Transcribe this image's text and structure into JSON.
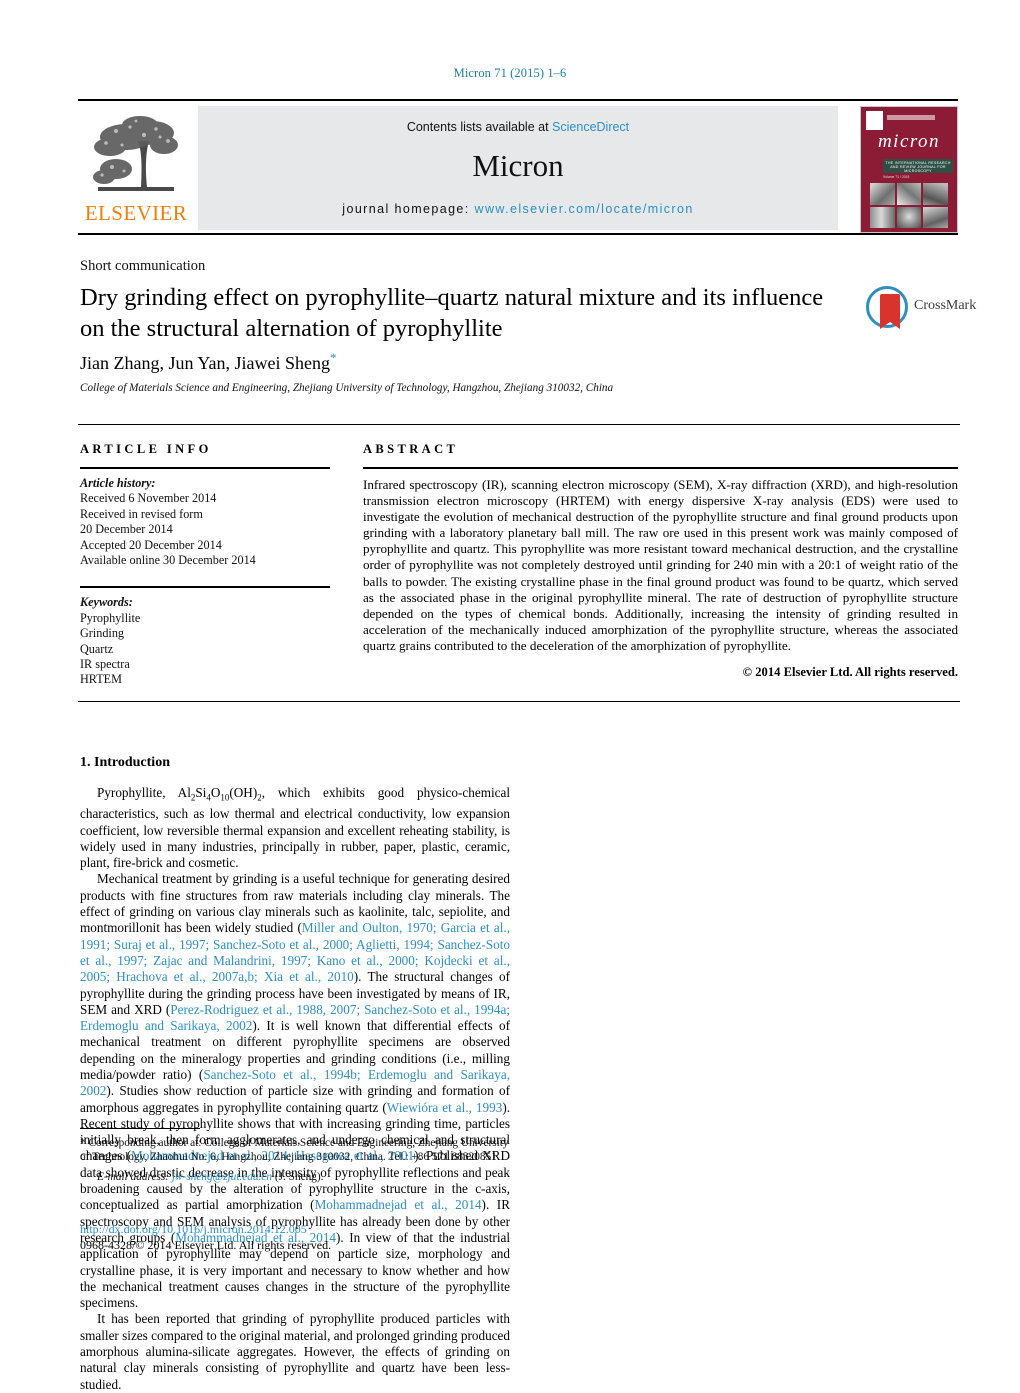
{
  "running_head": "Micron 71 (2015) 1–6",
  "masthead": {
    "contents_label": "Contents lists available at",
    "sciencedirect": "ScienceDirect",
    "journal_name": "Micron",
    "homepage_label": "journal homepage:",
    "homepage_url": "www.elsevier.com/locate/micron",
    "publisher_logo_text": "ELSEVIER",
    "cover": {
      "title": "micron",
      "band_text": "THE INTERNATIONAL RESEARCH AND REVIEW JOURNAL FOR MICROSCOPY",
      "sub_text": "Volume 71 / 2015"
    }
  },
  "article": {
    "doctype": "Short communication",
    "title": "Dry grinding effect on pyrophyllite–quartz natural mixture and its influence on the structural alternation of pyrophyllite",
    "authors": "Jian Zhang, Jun Yan, Jiawei Sheng",
    "corresponding_marker": "*",
    "affiliation": "College of Materials Science and Engineering, Zhejiang University of Technology, Hangzhou, Zhejiang 310032, China",
    "crossmark_label": "CrossMark"
  },
  "info": {
    "heading": "ARTICLE INFO",
    "history_label": "Article history:",
    "history": [
      "Received 6 November 2014",
      "Received in revised form",
      "20 December 2014",
      "Accepted 20 December 2014",
      "Available online 30 December 2014"
    ],
    "keywords_label": "Keywords:",
    "keywords": [
      "Pyrophyllite",
      "Grinding",
      "Quartz",
      "IR spectra",
      "HRTEM"
    ]
  },
  "abstract": {
    "heading": "ABSTRACT",
    "text": "Infrared spectroscopy (IR), scanning electron microscopy (SEM), X-ray diffraction (XRD), and high-resolution transmission electron microscopy (HRTEM) with energy dispersive X-ray analysis (EDS) were used to investigate the evolution of mechanical destruction of the pyrophyllite structure and final ground products upon grinding with a laboratory planetary ball mill. The raw ore used in this present work was mainly composed of pyrophyllite and quartz. This pyrophyllite was more resistant toward mechanical destruction, and the crystalline order of pyrophyllite was not completely destroyed until grinding for 240 min with a 20:1 of weight ratio of the balls to powder. The existing crystalline phase in the final ground product was found to be quartz, which served as the associated phase in the original pyrophyllite mineral. The rate of destruction of pyrophyllite structure depended on the types of chemical bonds. Additionally, increasing the intensity of grinding resulted in acceleration of the mechanically induced amorphization of the pyrophyllite structure, whereas the associated quartz grains contributed to the deceleration of the amorphization of pyrophyllite.",
    "copyright": "© 2014 Elsevier Ltd. All rights reserved."
  },
  "introduction": {
    "heading": "1. Introduction",
    "p1_a": "Pyrophyllite, Al",
    "p1_sub1": "2",
    "p1_b": "Si",
    "p1_sub2": "4",
    "p1_c": "O",
    "p1_sub3": "10",
    "p1_d": "(OH)",
    "p1_sub4": "2",
    "p1_e": ", which exhibits good physico-chemical characteristics, such as low thermal and electrical conductivity, low expansion coefficient, low reversible thermal expansion and excellent reheating stability, is widely used in many industries, principally in rubber, paper, plastic, ceramic, plant, fire-brick and cosmetic.",
    "p2_a": "Mechanical treatment by grinding is a useful technique for generating desired products with fine structures from raw materials including clay minerals. The effect of grinding on various clay minerals such as kaolinite, talc, sepiolite, and montmorillonit has been widely studied (",
    "p2_cite1": "Miller and Oulton, 1970; Garcia et al., 1991; Suraj et al., 1997; Sanchez-Soto et al., 2000; Aglietti, 1994; Sanchez-Soto et al., 1997; Zajac and Malandrini, 1997; Kano et al., 2000; Kojdecki et al., 2005; Hrachova et al., 2007a,b; Xia et al., 2010",
    "p2_b": "). The structural changes of pyrophyllite during the grinding process have been investigated by means of IR, SEM and XRD (",
    "p2_cite2": "Perez-Rodriguez et al., 1988, 2007; Sanchez-Soto et al., 1994a; Erdemoglu and Sarikaya, 2002",
    "p2_c": "). It is well known that differential effects of mechanical treatment on different pyrophyllite specimens are observed depending on the mineralogy properties and grinding conditions (i.e., milling media/powder ratio) (",
    "p2_cite3": "Sanchez-Soto et al., 1994b; Erdemoglu and Sarikaya, 2002",
    "p2_d": "). Studies show reduction of particle size with grinding and formation of amorphous aggregates in pyrophyllite containing quartz (",
    "p2_cite4": "Wiewióra et al., 1993",
    "p2_e": "). Recent study of pyrophyllite shows that with increasing grinding time, particles initially break, then form agglomerates, and undergo chemical and structural changes (",
    "p2_cite5": "Mohammadnejad et al., 2014; Hasegawa et al., 2001",
    "p2_f": "). Published XRD data showed drastic decrease in the intensity of pyrophyllite reflections and peak broadening caused by the alteration of pyrophyllite structure in the c-axis, conceptualized as partial amorphization (",
    "p2_cite6": "Mohammadnejad et al., 2014",
    "p2_g": "). IR spectroscopy and SEM analysis of pyrophyllite has already been done by other research groups (",
    "p2_cite7": "Mohammadnejad et al., 2014",
    "p2_h": "). In view of that the industrial application of pyrophyllite may depend on particle size, morphology and crystalline phase, it is very important and necessary to know whether and how the mechanical treatment causes changes in the structure of the pyrophyllite specimens.",
    "p3": "It has been reported that grinding of pyrophyllite produced particles with smaller sizes compared to the original material, and prolonged grinding produced amorphous alumina-silicate aggregates. However, the effects of grinding on natural clay minerals consisting of pyrophyllite and quartz have been less-studied."
  },
  "footer": {
    "corresponding_note": "* Corresponding author at: College of Materials Science and Engineering, Zhejiang University of Technology, Zhaohui No. 6, Hangzhou, Zhejiang 310032, China. Tel.: +86 571 88320851.",
    "email_label": "E-mail address:",
    "email": "jw-sheng@zjut.edu.cn",
    "email_owner": "(J. Sheng).",
    "doi": "http://dx.doi.org/10.1016/j.micron.2014.12.005",
    "issn": "0968-4328/© 2014 Elsevier Ltd. All rights reserved."
  }
}
